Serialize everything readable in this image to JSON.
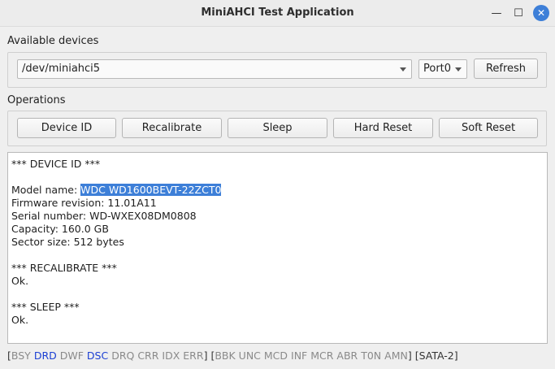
{
  "window": {
    "title": "MiniAHCI Test Application",
    "minimize_glyph": "—",
    "maximize_glyph": "☐",
    "close_glyph": "✕"
  },
  "devices": {
    "label": "Available devices",
    "selected_device": "/dev/miniahci5",
    "selected_port": "Port0",
    "refresh_label": "Refresh"
  },
  "operations": {
    "label": "Operations",
    "buttons": [
      "Device ID",
      "Recalibrate",
      "Sleep",
      "Hard Reset",
      "Soft Reset"
    ]
  },
  "output": {
    "lines": [
      "*** DEVICE ID ***",
      "",
      "Model name: ",
      "Firmware revision: 11.01A11",
      "Serial number: WD-WXEX08DM0808",
      "Capacity: 160.0 GB",
      "Sector size: 512 bytes",
      "",
      "*** RECALIBRATE ***",
      "Ok.",
      "",
      "*** SLEEP ***",
      "Ok."
    ],
    "selected_text": "WDC WD1600BEVT-22ZCT0"
  },
  "status": {
    "open1": "[",
    "flags1": [
      {
        "text": "BSY",
        "active": false
      },
      {
        "text": "DRD",
        "active": true
      },
      {
        "text": "DWF",
        "active": false
      },
      {
        "text": "DSC",
        "active": true
      },
      {
        "text": "DRQ",
        "active": false
      },
      {
        "text": "CRR",
        "active": false
      },
      {
        "text": "IDX",
        "active": false
      },
      {
        "text": "ERR",
        "active": false
      }
    ],
    "close1": "]",
    "open2": "[",
    "flags2": [
      {
        "text": "BBK",
        "active": false
      },
      {
        "text": "UNC",
        "active": false
      },
      {
        "text": "MCD",
        "active": false
      },
      {
        "text": "INF",
        "active": false
      },
      {
        "text": "MCR",
        "active": false
      },
      {
        "text": "ABR",
        "active": false
      },
      {
        "text": "T0N",
        "active": false
      },
      {
        "text": "AMN",
        "active": false
      }
    ],
    "close2": "]",
    "link": "[SATA-2]",
    "colors": {
      "active": "#1b3fd3",
      "inactive": "#8a8a8a"
    }
  }
}
